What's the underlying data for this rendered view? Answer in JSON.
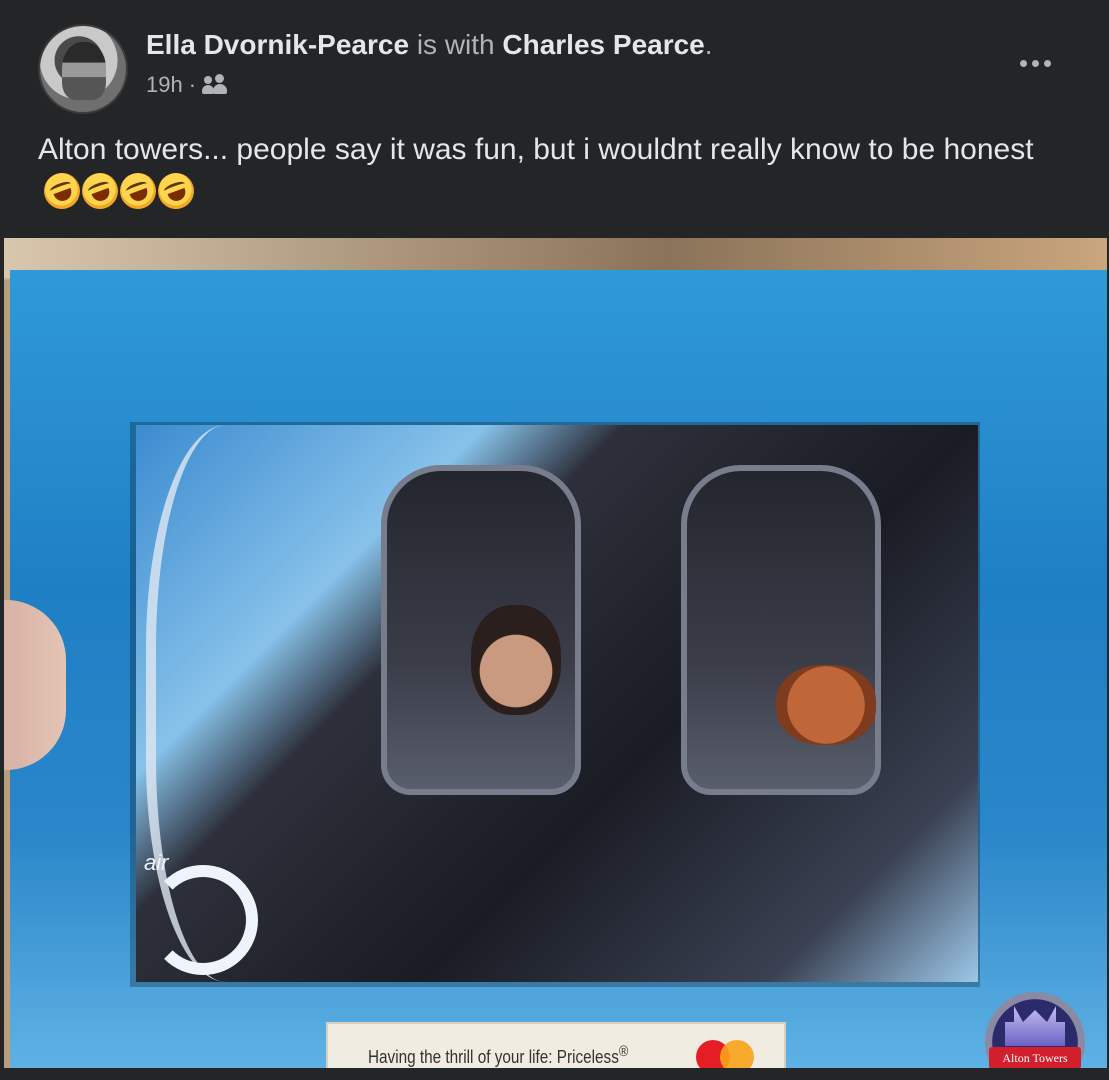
{
  "post": {
    "author": "Ella Dvornik-Pearce",
    "with_text": "is with",
    "tagged": "Charles Pearce",
    "period": ".",
    "time": "19h",
    "separator": "·",
    "audience_icon": "friends-icon",
    "text": "Alton towers... people say it was fun, but i wouldnt really know to be honest",
    "emoji": [
      "rolling-on-floor-laughing",
      "rolling-on-floor-laughing",
      "rolling-on-floor-laughing",
      "rolling-on-floor-laughing"
    ]
  },
  "photo": {
    "banner_text": "Having the thrill of your life: Priceless",
    "banner_trademark": "®",
    "logo_text": "Alton Towers",
    "ride_logo": "air"
  },
  "colors": {
    "background": "#242526",
    "text": "#e4e6eb",
    "muted": "#b0b3b8",
    "folder_blue": "#1f7fc4"
  }
}
